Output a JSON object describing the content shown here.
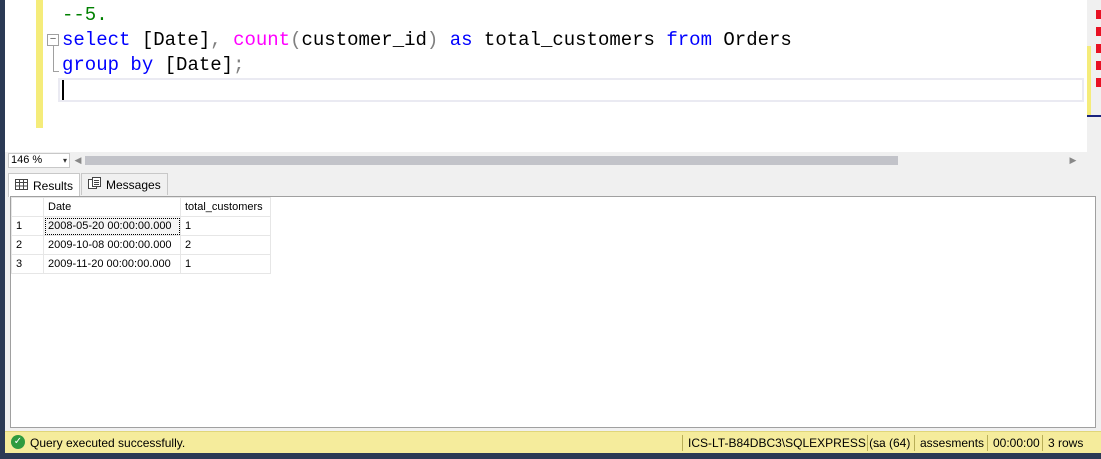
{
  "editor": {
    "line1": {
      "comment": "--5."
    },
    "line2": {
      "kw_select": "select",
      "t1": " [Date]",
      "comma": ",",
      "sp1": " ",
      "fn_count": "count",
      "paren_open": "(",
      "arg": "customer_id",
      "paren_close": ")",
      "sp2": " ",
      "kw_as": "as",
      "t2": " total_customers ",
      "kw_from": "from",
      "t3": " Orders"
    },
    "line3": {
      "kw_group": "group",
      "sp": " ",
      "kw_by": "by",
      "t1": " [Date]",
      "semi": ";"
    },
    "collapse_glyph": "−"
  },
  "zoom": {
    "value": "146 %",
    "arrow": "▾"
  },
  "scroll": {
    "left_arrow": "◀",
    "right_arrow": "▶"
  },
  "tabs": [
    {
      "label": "Results",
      "icon": "grid-icon"
    },
    {
      "label": "Messages",
      "icon": "messages-icon"
    }
  ],
  "results": {
    "columns": [
      "Date",
      "total_customers"
    ],
    "rows": [
      {
        "num": "1",
        "date": "2008-05-20 00:00:00.000",
        "total": "1"
      },
      {
        "num": "2",
        "date": "2009-10-08 00:00:00.000",
        "total": "2"
      },
      {
        "num": "3",
        "date": "2009-11-20 00:00:00.000",
        "total": "1"
      }
    ]
  },
  "status": {
    "icon": "check-circle-icon",
    "check": "✓",
    "message": "Query executed successfully.",
    "server": "ICS-LT-B84DBC3\\SQLEXPRESS (...",
    "user": "sa (64)",
    "database": "assesments",
    "elapsed": "00:00:00",
    "rows": "3 rows"
  },
  "colors": {
    "keyword": "#0000ff",
    "function": "#ff00ff",
    "comment": "#008000",
    "status_bg": "#f5ec9c"
  }
}
